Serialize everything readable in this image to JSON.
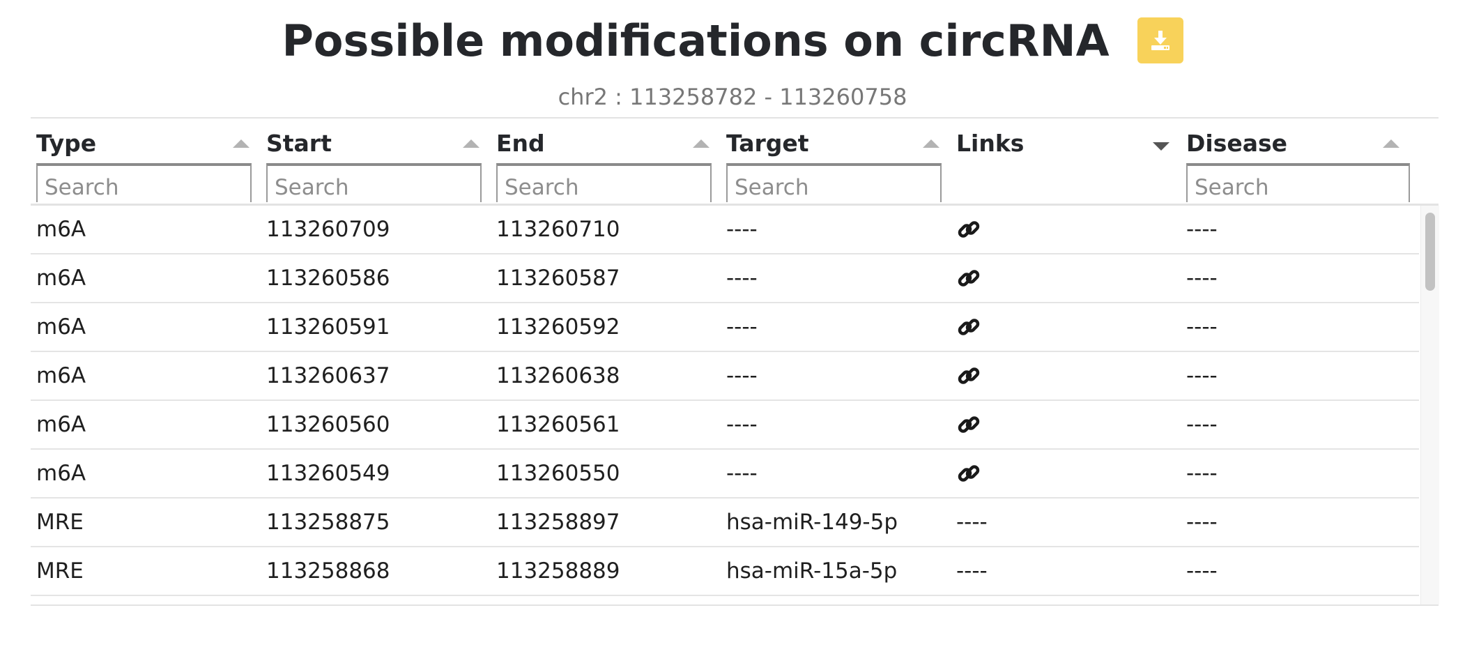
{
  "header": {
    "title": "Possible modifications on circRNA",
    "download_icon": "download-icon",
    "accent_color": "#f8d25a",
    "subtitle": "chr2 : 113258782 - 113260758"
  },
  "table": {
    "columns": [
      {
        "label": "Type",
        "sort": "asc",
        "search_placeholder": "Search"
      },
      {
        "label": "Start",
        "sort": "asc",
        "search_placeholder": "Search"
      },
      {
        "label": "End",
        "sort": "asc",
        "search_placeholder": "Search"
      },
      {
        "label": "Target",
        "sort": "asc",
        "search_placeholder": "Search"
      },
      {
        "label": "Links",
        "sort": "desc",
        "search_placeholder": ""
      },
      {
        "label": "Disease",
        "sort": "asc",
        "search_placeholder": "Search"
      }
    ],
    "rows": [
      {
        "type": "m6A",
        "start": "113260709",
        "end": "113260710",
        "target": "----",
        "links": "link-icon",
        "disease": "----"
      },
      {
        "type": "m6A",
        "start": "113260586",
        "end": "113260587",
        "target": "----",
        "links": "link-icon",
        "disease": "----"
      },
      {
        "type": "m6A",
        "start": "113260591",
        "end": "113260592",
        "target": "----",
        "links": "link-icon",
        "disease": "----"
      },
      {
        "type": "m6A",
        "start": "113260637",
        "end": "113260638",
        "target": "----",
        "links": "link-icon",
        "disease": "----"
      },
      {
        "type": "m6A",
        "start": "113260560",
        "end": "113260561",
        "target": "----",
        "links": "link-icon",
        "disease": "----"
      },
      {
        "type": "m6A",
        "start": "113260549",
        "end": "113260550",
        "target": "----",
        "links": "link-icon",
        "disease": "----"
      },
      {
        "type": "MRE",
        "start": "113258875",
        "end": "113258897",
        "target": "hsa-miR-149-5p",
        "links": "----",
        "disease": "----"
      },
      {
        "type": "MRE",
        "start": "113258868",
        "end": "113258889",
        "target": "hsa-miR-15a-5p",
        "links": "----",
        "disease": "----"
      }
    ]
  }
}
